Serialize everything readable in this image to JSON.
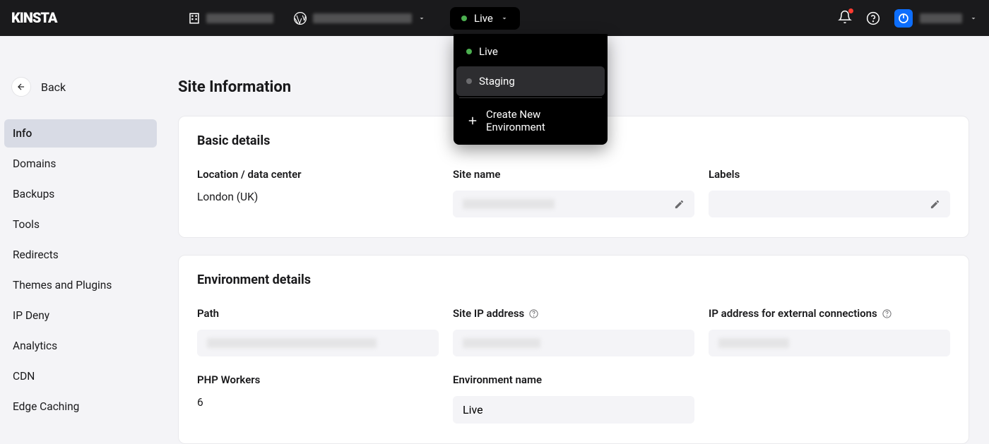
{
  "header": {
    "logo": "KINSTA",
    "env_selector_label": "Live",
    "dropdown": {
      "items": [
        {
          "label": "Live",
          "status": "green"
        },
        {
          "label": "Staging",
          "status": "gray"
        }
      ],
      "create_label": "Create New Environment"
    }
  },
  "sidebar": {
    "back_label": "Back",
    "items": [
      {
        "label": "Info",
        "active": true
      },
      {
        "label": "Domains"
      },
      {
        "label": "Backups"
      },
      {
        "label": "Tools"
      },
      {
        "label": "Redirects"
      },
      {
        "label": "Themes and Plugins"
      },
      {
        "label": "IP Deny"
      },
      {
        "label": "Analytics"
      },
      {
        "label": "CDN"
      },
      {
        "label": "Edge Caching"
      }
    ]
  },
  "main": {
    "page_title": "Site Information",
    "basic_details": {
      "title": "Basic details",
      "location_label": "Location / data center",
      "location_value": "London (UK)",
      "site_name_label": "Site name",
      "labels_label": "Labels"
    },
    "env_details": {
      "title": "Environment details",
      "path_label": "Path",
      "site_ip_label": "Site IP address",
      "ext_ip_label": "IP address for external connections",
      "php_workers_label": "PHP Workers",
      "php_workers_value": "6",
      "env_name_label": "Environment name",
      "env_name_value": "Live"
    }
  }
}
